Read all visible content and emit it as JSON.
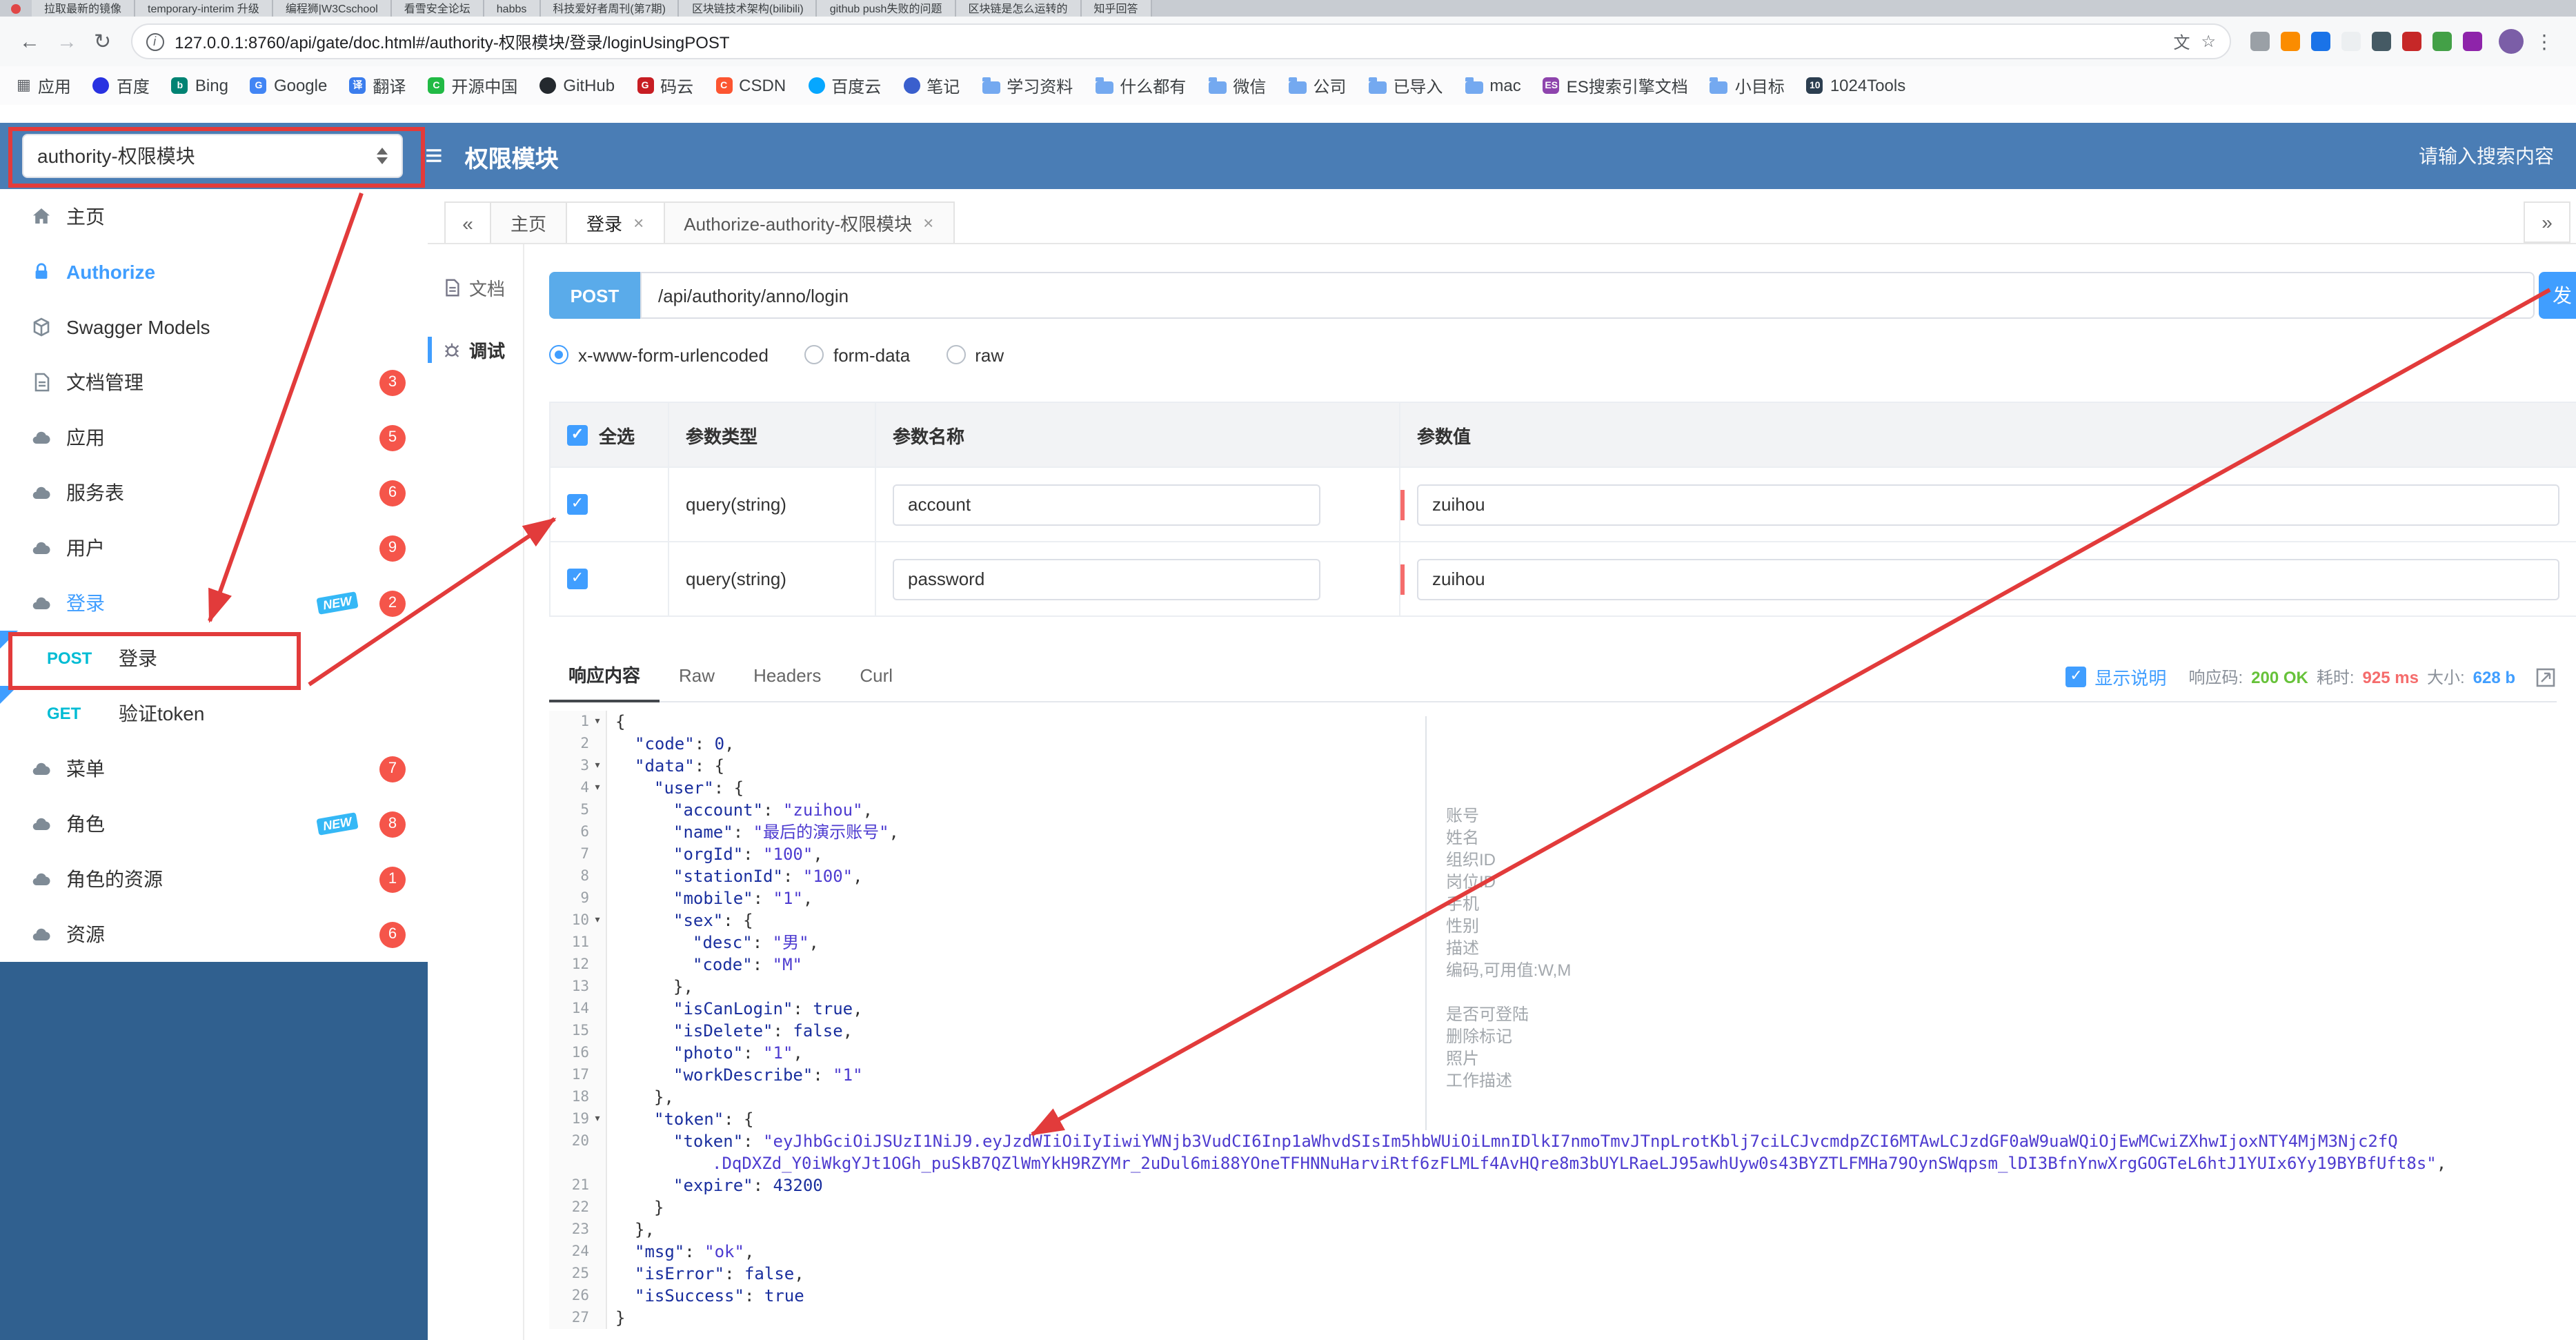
{
  "colors": {
    "accent": "#409eff",
    "header-blue": "#4a7db5",
    "sidebar-deep": "#30608f",
    "pill-blue": "#5aabea",
    "method-teal": "#00bcd4",
    "badge-red": "#f5554a",
    "ok-green": "#67c23a",
    "time-red": "#f56c6c",
    "size-blue": "#409eff",
    "red": "#e23b3b",
    "key-blue": "#1a2f9e",
    "str-blue": "#4d3bd0",
    "ann-gray": "#a3a8ad"
  },
  "browser": {
    "tab_strip": {
      "tabs": [
        "拉取最新的镜像",
        "temporary-interim 升级",
        "编程狮|W3Cschool",
        "看雪安全论坛",
        "habbs",
        "科技爱好者周刊(第7期)",
        "区块链技术架构(bilibili)",
        "github push失败的问题",
        "区块链是怎么运转的",
        "知乎回答"
      ]
    },
    "navbar": {
      "url": "127.0.0.1:8760/api/gate/doc.html#/authority-权限模块/登录/loginUsingPOST",
      "extensions": [
        "#9aa0a6",
        "#fb8c00",
        "#1a73e8",
        "#eceff1",
        "#455a64",
        "#c62828",
        "#43a047",
        "#8e24aa"
      ]
    },
    "bookmarks": [
      {
        "label": "应用",
        "icon": "grid"
      },
      {
        "label": "百度",
        "icon": "dot",
        "color": "#2932e1"
      },
      {
        "label": "Bing",
        "icon": "letter",
        "color": "#008373",
        "letter": "b"
      },
      {
        "label": "Google",
        "icon": "letter",
        "color": "#4285f4",
        "letter": "G"
      },
      {
        "label": "翻译",
        "icon": "letter",
        "color": "#3b7ded",
        "letter": "译"
      },
      {
        "label": "开源中国",
        "icon": "letter",
        "color": "#21ba45",
        "letter": "C"
      },
      {
        "label": "GitHub",
        "icon": "dot",
        "color": "#24292e"
      },
      {
        "label": "码云",
        "icon": "letter",
        "color": "#c71d23",
        "letter": "G"
      },
      {
        "label": "CSDN",
        "icon": "letter",
        "color": "#fc5531",
        "letter": "C"
      },
      {
        "label": "百度云",
        "icon": "dot",
        "color": "#06a7ff"
      },
      {
        "label": "笔记",
        "icon": "dot",
        "color": "#3a5fcd"
      },
      {
        "label": "学习资料",
        "icon": "folder"
      },
      {
        "label": "什么都有",
        "icon": "folder"
      },
      {
        "label": "微信",
        "icon": "folder"
      },
      {
        "label": "公司",
        "icon": "folder"
      },
      {
        "label": "已导入",
        "icon": "folder"
      },
      {
        "label": "mac",
        "icon": "folder"
      },
      {
        "label": "ES搜索引擎文档",
        "icon": "letter",
        "color": "#8e44ad",
        "letter": "ES"
      },
      {
        "label": "小目标",
        "icon": "folder"
      },
      {
        "label": "1024Tools",
        "icon": "letter",
        "color": "#2c3e50",
        "letter": "10"
      }
    ]
  },
  "header": {
    "module_select_value": "authority-权限模块",
    "title": "权限模块",
    "search_placeholder": "请输入搜索内容"
  },
  "sidebar": {
    "items": [
      {
        "type": "nav",
        "icon": "home-icon",
        "label": "主页"
      },
      {
        "type": "nav",
        "icon": "lock-icon",
        "label": "Authorize",
        "accent": true
      },
      {
        "type": "nav",
        "icon": "models-icon",
        "label": "Swagger Models"
      },
      {
        "type": "nav",
        "icon": "docs-icon",
        "label": "文档管理",
        "badge": "3"
      },
      {
        "type": "nav",
        "icon": "cloud-icon",
        "label": "应用",
        "badge": "5"
      },
      {
        "type": "nav",
        "icon": "cloud-icon",
        "label": "服务表",
        "badge": "6"
      },
      {
        "type": "nav",
        "icon": "cloud-icon",
        "label": "用户",
        "badge": "9"
      },
      {
        "type": "nav",
        "icon": "cloud-icon",
        "label": "登录",
        "badge": "2",
        "new": "NEW",
        "active": true
      },
      {
        "type": "api",
        "method": "POST",
        "label": "登录"
      },
      {
        "type": "api",
        "method": "GET",
        "label": "验证token"
      },
      {
        "type": "nav",
        "icon": "cloud-icon",
        "label": "菜单",
        "badge": "7"
      },
      {
        "type": "nav",
        "icon": "cloud-icon",
        "label": "角色",
        "badge": "8",
        "new": "NEW"
      },
      {
        "type": "nav",
        "icon": "cloud-icon",
        "label": "角色的资源",
        "badge": "1"
      },
      {
        "type": "nav",
        "icon": "cloud-icon",
        "label": "资源",
        "badge": "6"
      }
    ]
  },
  "doc_tabs": {
    "collapse": "«",
    "more": "»",
    "tabs": [
      {
        "label": "主页",
        "closable": false,
        "active": false
      },
      {
        "label": "登录",
        "closable": true,
        "active": true
      },
      {
        "label": "Authorize-authority-权限模块",
        "closable": true,
        "active": false
      }
    ]
  },
  "rail": {
    "items": [
      {
        "label": "文档",
        "icon": "doc-icon",
        "active": false
      },
      {
        "label": "调试",
        "icon": "debug-icon",
        "active": true
      }
    ]
  },
  "request": {
    "method": "POST",
    "url": "/api/authority/anno/login",
    "send_label": "发",
    "body_types": [
      "x-www-form-urlencoded",
      "form-data",
      "raw"
    ],
    "selected_body_type": "x-www-form-urlencoded"
  },
  "params": {
    "headers": [
      "全选",
      "参数类型",
      "参数名称",
      "参数值"
    ],
    "select_all_checked": true,
    "rows": [
      {
        "checked": true,
        "type": "query(string)",
        "name": "account",
        "value": "zuihou"
      },
      {
        "checked": true,
        "type": "query(string)",
        "name": "password",
        "value": "zuihou"
      }
    ]
  },
  "response_bar": {
    "tabs": [
      "响应内容",
      "Raw",
      "Headers",
      "Curl"
    ],
    "active_tab": "响应内容",
    "show_desc_checked": true,
    "show_desc_label": "显示说明",
    "status_label": "响应码:",
    "status": "200 OK",
    "time_label": "耗时:",
    "time": "925 ms",
    "size_label": "大小:",
    "size": "628 b"
  },
  "code": {
    "lines": [
      {
        "n": 1,
        "ind": 0,
        "fold": true,
        "seg": [
          [
            "p",
            "{"
          ]
        ]
      },
      {
        "n": 2,
        "ind": 1,
        "seg": [
          [
            "k",
            "code"
          ],
          [
            "p",
            ": "
          ],
          [
            "n",
            "0"
          ],
          [
            "p",
            ","
          ]
        ]
      },
      {
        "n": 3,
        "ind": 1,
        "fold": true,
        "seg": [
          [
            "k",
            "data"
          ],
          [
            "p",
            ": {"
          ]
        ]
      },
      {
        "n": 4,
        "ind": 2,
        "fold": true,
        "seg": [
          [
            "k",
            "user"
          ],
          [
            "p",
            ": {"
          ]
        ]
      },
      {
        "n": 5,
        "ind": 3,
        "seg": [
          [
            "k",
            "account"
          ],
          [
            "p",
            ": "
          ],
          [
            "s",
            "zuihou"
          ],
          [
            "p",
            ","
          ]
        ]
      },
      {
        "n": 6,
        "ind": 3,
        "seg": [
          [
            "k",
            "name"
          ],
          [
            "p",
            ": "
          ],
          [
            "s",
            "最后的演示账号"
          ],
          [
            "p",
            ","
          ]
        ]
      },
      {
        "n": 7,
        "ind": 3,
        "seg": [
          [
            "k",
            "orgId"
          ],
          [
            "p",
            ": "
          ],
          [
            "s",
            "100"
          ],
          [
            "p",
            ","
          ]
        ]
      },
      {
        "n": 8,
        "ind": 3,
        "seg": [
          [
            "k",
            "stationId"
          ],
          [
            "p",
            ": "
          ],
          [
            "s",
            "100"
          ],
          [
            "p",
            ","
          ]
        ]
      },
      {
        "n": 9,
        "ind": 3,
        "seg": [
          [
            "k",
            "mobile"
          ],
          [
            "p",
            ": "
          ],
          [
            "s",
            "1"
          ],
          [
            "p",
            ","
          ]
        ]
      },
      {
        "n": 10,
        "ind": 3,
        "fold": true,
        "seg": [
          [
            "k",
            "sex"
          ],
          [
            "p",
            ": {"
          ]
        ]
      },
      {
        "n": 11,
        "ind": 4,
        "seg": [
          [
            "k",
            "desc"
          ],
          [
            "p",
            ": "
          ],
          [
            "s",
            "男"
          ],
          [
            "p",
            ","
          ]
        ]
      },
      {
        "n": 12,
        "ind": 4,
        "seg": [
          [
            "k",
            "code"
          ],
          [
            "p",
            ": "
          ],
          [
            "s",
            "M"
          ]
        ]
      },
      {
        "n": 13,
        "ind": 3,
        "seg": [
          [
            "p",
            "},"
          ]
        ]
      },
      {
        "n": 14,
        "ind": 3,
        "seg": [
          [
            "k",
            "isCanLogin"
          ],
          [
            "p",
            ": "
          ],
          [
            "b",
            "true"
          ],
          [
            "p",
            ","
          ]
        ]
      },
      {
        "n": 15,
        "ind": 3,
        "seg": [
          [
            "k",
            "isDelete"
          ],
          [
            "p",
            ": "
          ],
          [
            "b",
            "false"
          ],
          [
            "p",
            ","
          ]
        ]
      },
      {
        "n": 16,
        "ind": 3,
        "seg": [
          [
            "k",
            "photo"
          ],
          [
            "p",
            ": "
          ],
          [
            "s",
            "1"
          ],
          [
            "p",
            ","
          ]
        ]
      },
      {
        "n": 17,
        "ind": 3,
        "seg": [
          [
            "k",
            "workDescribe"
          ],
          [
            "p",
            ": "
          ],
          [
            "s",
            "1"
          ]
        ]
      },
      {
        "n": 18,
        "ind": 2,
        "seg": [
          [
            "p",
            "},"
          ]
        ]
      },
      {
        "n": 19,
        "ind": 2,
        "fold": true,
        "seg": [
          [
            "k",
            "token"
          ],
          [
            "p",
            ": {"
          ]
        ]
      },
      {
        "n": 20,
        "ind": 3,
        "seg": [
          [
            "k",
            "token"
          ],
          [
            "p",
            ": "
          ],
          [
            "sr",
            "\"eyJhbGciOiJSUzI1NiJ9.eyJzdWIiOiIyIiwiYWNjb3VudCI6Inp1aWhvdSIsIm5hbWUiOiLmnIDlkI7nmoTmvJTnpLrotKblj7ciLCJvcmdpZCI6MTAwLCJzdGF0aW9uaWQiOjEwMCwiZXhwIjoxNTY4MjM3Njc2fQ"
          ]
        ]
      },
      {
        "n": "",
        "ind": 5,
        "seg": [
          [
            "sr",
            ".DqDXZd_Y0iWkgYJt1OGh_puSkB7QZlWmYkH9RZYMr_2uDul6mi88YOneTFHNNuHarviRtf6zFLMLf4AvHQre8m3bUYLRaeLJ95awhUyw0s43BYZTLFMHa79OynSWqpsm_lDI3BfnYnwXrgGOGTeL6htJ1YUIx6Yy19BYBfUft8s\""
          ],
          [
            "p",
            ","
          ]
        ]
      },
      {
        "n": 21,
        "ind": 3,
        "seg": [
          [
            "k",
            "expire"
          ],
          [
            "p",
            ": "
          ],
          [
            "n",
            "43200"
          ]
        ]
      },
      {
        "n": 22,
        "ind": 2,
        "seg": [
          [
            "p",
            "}"
          ]
        ]
      },
      {
        "n": 23,
        "ind": 1,
        "seg": [
          [
            "p",
            "},"
          ]
        ]
      },
      {
        "n": 24,
        "ind": 1,
        "seg": [
          [
            "k",
            "msg"
          ],
          [
            "p",
            ": "
          ],
          [
            "s",
            "ok"
          ],
          [
            "p",
            ","
          ]
        ]
      },
      {
        "n": 25,
        "ind": 1,
        "seg": [
          [
            "k",
            "isError"
          ],
          [
            "p",
            ": "
          ],
          [
            "b",
            "false"
          ],
          [
            "p",
            ","
          ]
        ]
      },
      {
        "n": 26,
        "ind": 1,
        "seg": [
          [
            "k",
            "isSuccess"
          ],
          [
            "p",
            ": "
          ],
          [
            "b",
            "true"
          ]
        ]
      },
      {
        "n": 27,
        "ind": 0,
        "seg": [
          [
            "p",
            "}"
          ]
        ]
      }
    ],
    "annotations": [
      {
        "line": 5,
        "text": "账号"
      },
      {
        "line": 6,
        "text": "姓名"
      },
      {
        "line": 7,
        "text": "组织ID"
      },
      {
        "line": 8,
        "text": "岗位ID"
      },
      {
        "line": 9,
        "text": "手机"
      },
      {
        "line": 10,
        "text": "性别"
      },
      {
        "line": 11,
        "text": "描述"
      },
      {
        "line": 12,
        "text": "编码,可用值:W,M"
      },
      {
        "line": 14,
        "text": "是否可登陆"
      },
      {
        "line": 15,
        "text": "删除标记"
      },
      {
        "line": 16,
        "text": "照片"
      },
      {
        "line": 17,
        "text": "工作描述"
      }
    ]
  }
}
